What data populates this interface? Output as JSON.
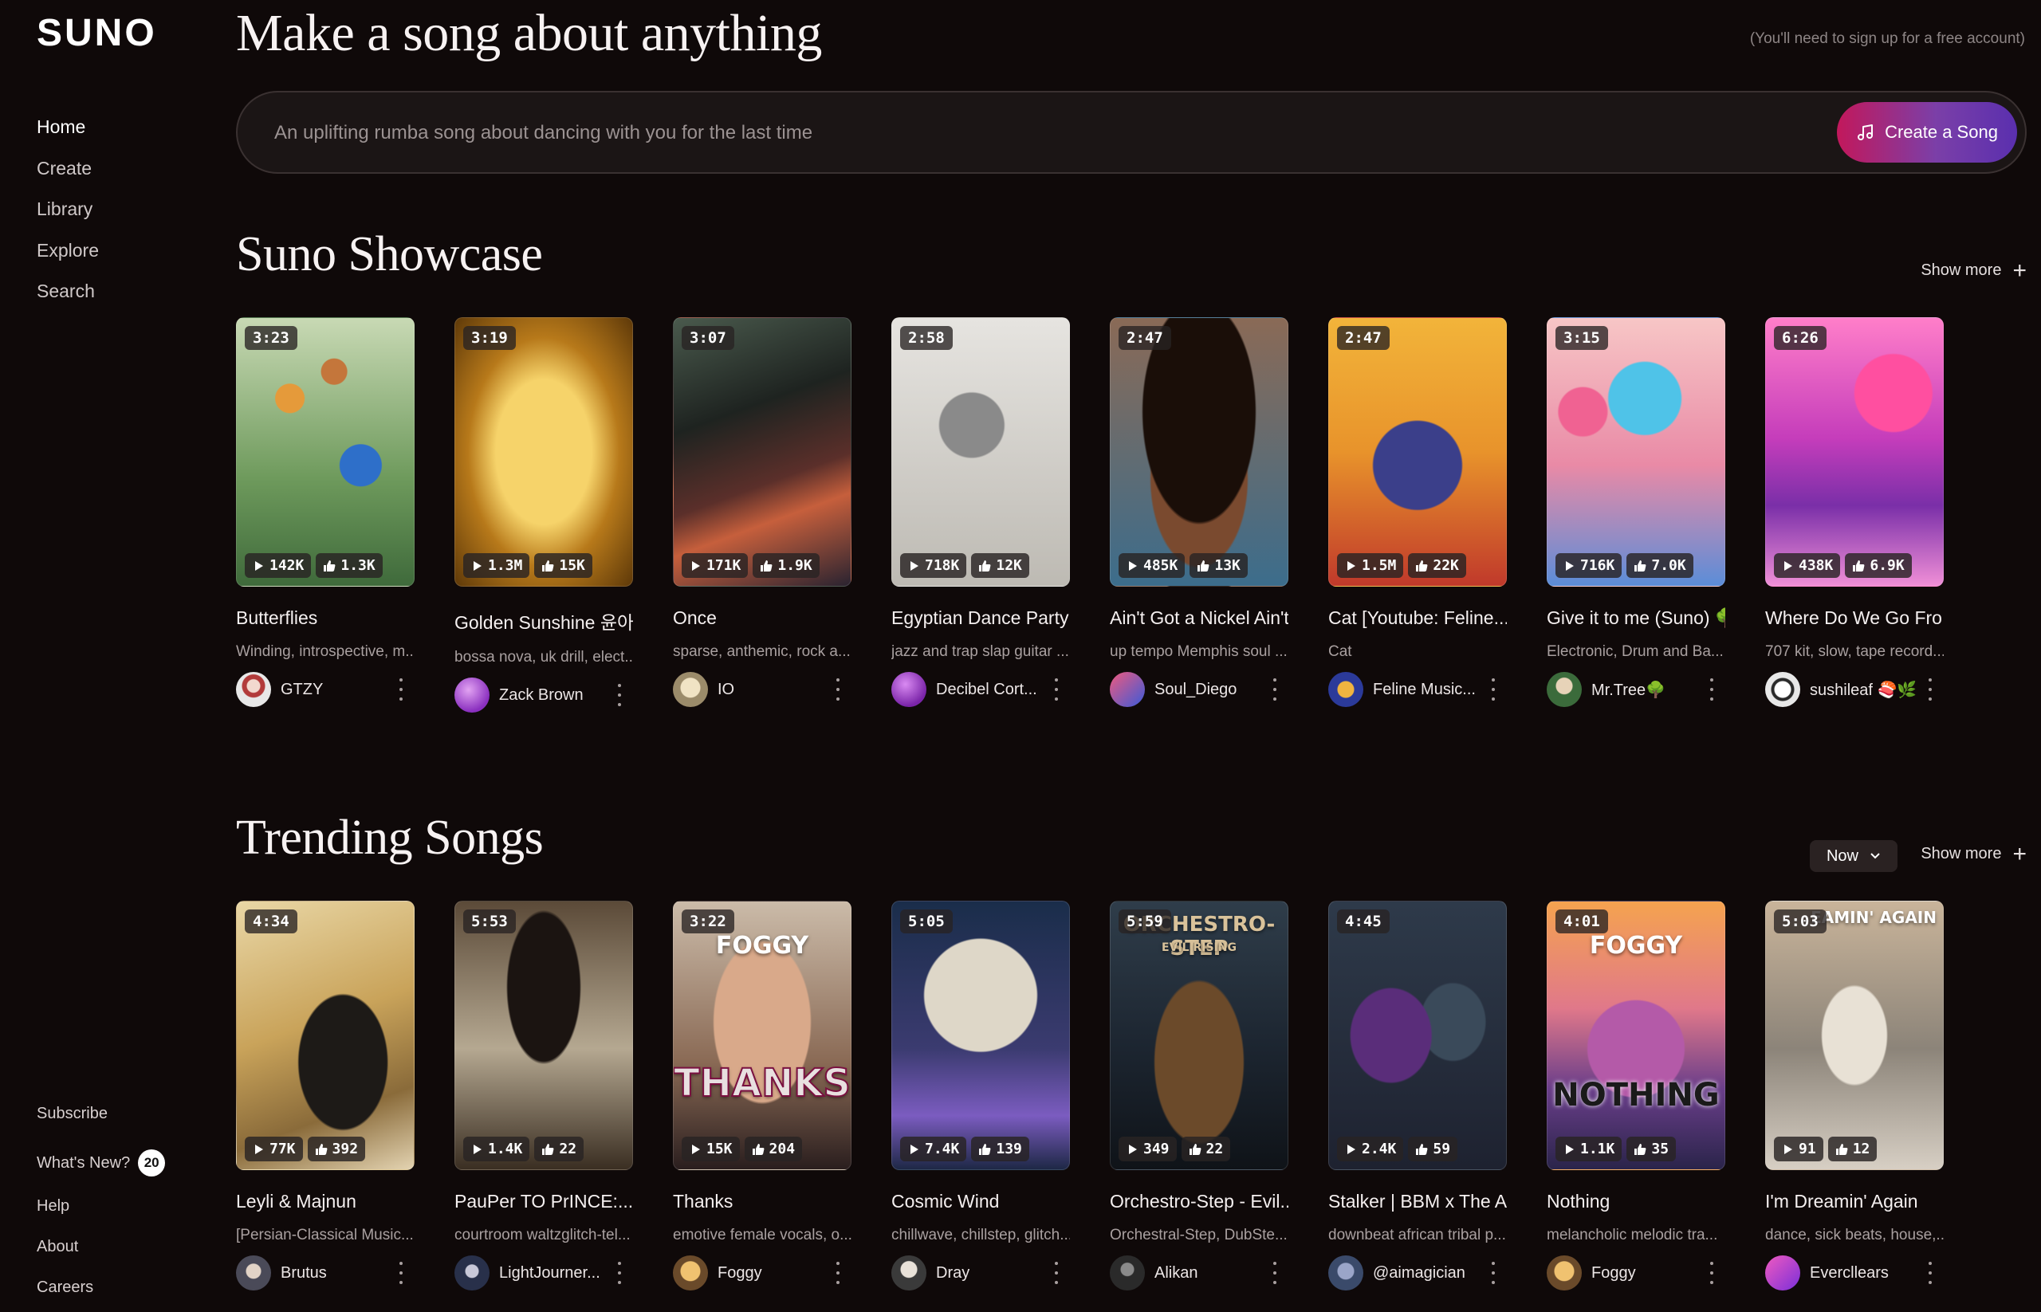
{
  "sidebar": {
    "logo": "SUNO",
    "nav": [
      "Home",
      "Create",
      "Library",
      "Explore",
      "Search"
    ],
    "bottom": {
      "subscribe": "Subscribe",
      "whats_new": "What's New?",
      "whats_new_count": "20",
      "help": "Help",
      "about": "About",
      "careers": "Careers"
    }
  },
  "header": {
    "headline": "Make a song about anything",
    "signup_note": "(You'll need to sign up for a free account)",
    "prompt_placeholder": "An uplifting rumba song about dancing with you for the last time",
    "create_label": "Create a Song",
    "create_icon": "music-note-icon"
  },
  "showcase": {
    "title": "Suno Showcase",
    "show_more": "Show more",
    "songs": [
      {
        "duration": "3:23",
        "plays": "142K",
        "likes": "1.3K",
        "title": "Butterflies",
        "desc": "Winding, introspective, m...",
        "author": "GTZY"
      },
      {
        "duration": "3:19",
        "plays": "1.3M",
        "likes": "15K",
        "title": "Golden Sunshine 윤아",
        "desc": "bossa nova, uk drill, elect...",
        "author": "Zack Brown"
      },
      {
        "duration": "3:07",
        "plays": "171K",
        "likes": "1.9K",
        "title": "Once",
        "desc": "sparse, anthemic, rock a...",
        "author": "IO"
      },
      {
        "duration": "2:58",
        "plays": "718K",
        "likes": "12K",
        "title": "Egyptian Dance Party",
        "desc": "jazz and trap slap guitar ...",
        "author": "Decibel Cort..."
      },
      {
        "duration": "2:47",
        "plays": "485K",
        "likes": "13K",
        "title": "Ain't Got a Nickel Ain't...",
        "desc": "up tempo Memphis soul ...",
        "author": "Soul_Diego"
      },
      {
        "duration": "2:47",
        "plays": "1.5M",
        "likes": "22K",
        "title": "Cat [Youtube: Feline...",
        "desc": "Cat",
        "author": "Feline Music..."
      },
      {
        "duration": "3:15",
        "plays": "716K",
        "likes": "7.0K",
        "title": "Give it to me (Suno) 🌳",
        "desc": "Electronic, Drum and Ba...",
        "author": "Mr.Tree🌳"
      },
      {
        "duration": "6:26",
        "plays": "438K",
        "likes": "6.9K",
        "title": "Where Do We Go Fro...",
        "desc": "707 kit, slow, tape record...",
        "author": "sushileaf 🍣🌿"
      }
    ]
  },
  "trending": {
    "title": "Trending Songs",
    "filter": "Now",
    "show_more": "Show more",
    "songs": [
      {
        "duration": "4:34",
        "plays": "77K",
        "likes": "392",
        "title": "Leyli & Majnun",
        "desc": "[Persian-Classical Music...",
        "author": "Brutus"
      },
      {
        "duration": "5:53",
        "plays": "1.4K",
        "likes": "22",
        "title": "PauPer TO PrINCE:...",
        "desc": "courtroom waltzglitch-tel...",
        "author": "LightJourner..."
      },
      {
        "duration": "3:22",
        "plays": "15K",
        "likes": "204",
        "title": "Thanks",
        "desc": "emotive female vocals, o...",
        "author": "Foggy",
        "art_top": "FOGGY",
        "art_bottom": "THANKS"
      },
      {
        "duration": "5:05",
        "plays": "7.4K",
        "likes": "139",
        "title": "Cosmic Wind",
        "desc": "chillwave, chillstep, glitch...",
        "author": "Dray"
      },
      {
        "duration": "5:59",
        "plays": "349",
        "likes": "22",
        "title": "Orchestro-Step - Evil...",
        "desc": "Orchestral-Step, DubSte...",
        "author": "Alikan",
        "art_top": "ORCHESTRO-STEP",
        "art_sub": "EVIL RISING"
      },
      {
        "duration": "4:45",
        "plays": "2.4K",
        "likes": "59",
        "title": "Stalker | BBM x The A...",
        "desc": "downbeat african tribal p...",
        "author": "@aimagician"
      },
      {
        "duration": "4:01",
        "plays": "1.1K",
        "likes": "35",
        "title": "Nothing",
        "desc": "melancholic melodic tra...",
        "author": "Foggy",
        "art_top": "FOGGY",
        "art_bottom": "NOTHING"
      },
      {
        "duration": "5:03",
        "plays": "91",
        "likes": "12",
        "title": "I'm Dreamin' Again",
        "desc": "dance, sick beats, house,...",
        "author": "Evercllears",
        "art_top": "EAMIN' AGAIN"
      }
    ]
  },
  "colors": {
    "background": "#0f0909",
    "create_gradient_start": "#c2185b",
    "create_gradient_end": "#5a2fae"
  }
}
